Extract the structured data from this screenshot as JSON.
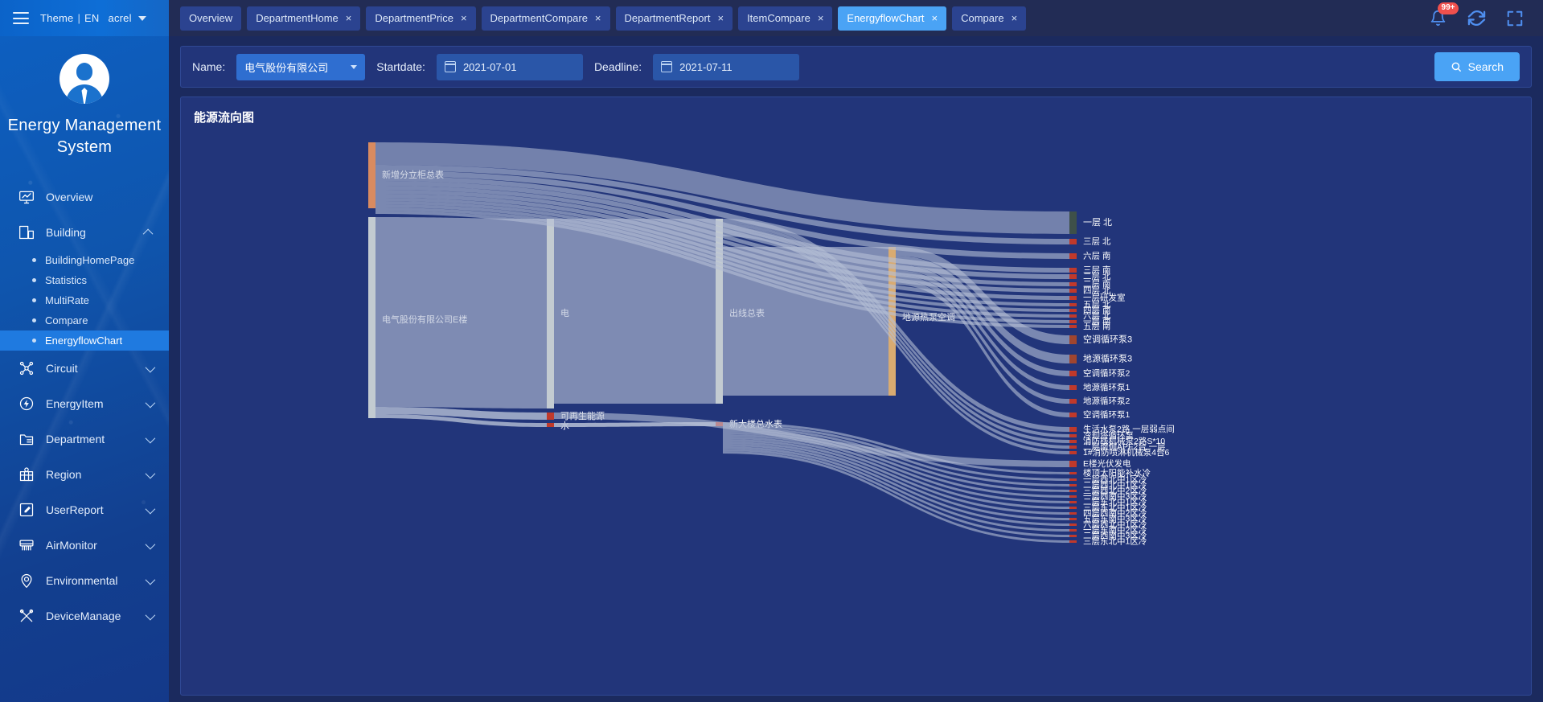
{
  "topbar": {
    "menu_icon": "hamburger-icon",
    "theme_label": "Theme",
    "divider": "|",
    "lang_label": "EN",
    "user_label": "acrel",
    "notification_badge": "99+",
    "tabs": [
      {
        "label": "Overview",
        "closable": false,
        "active": false
      },
      {
        "label": "DepartmentHome",
        "closable": true,
        "active": false
      },
      {
        "label": "DepartmentPrice",
        "closable": true,
        "active": false
      },
      {
        "label": "DepartmentCompare",
        "closable": true,
        "active": false
      },
      {
        "label": "DepartmentReport",
        "closable": true,
        "active": false
      },
      {
        "label": "ItemCompare",
        "closable": true,
        "active": false
      },
      {
        "label": "EnergyflowChart",
        "closable": true,
        "active": true
      },
      {
        "label": "Compare",
        "closable": true,
        "active": false
      }
    ],
    "close_glyph": "×",
    "icons": [
      "bell-icon",
      "refresh-icon",
      "fullscreen-icon"
    ]
  },
  "sidebar": {
    "brand_title": "Energy Management System",
    "avatar": "user-avatar",
    "items": [
      {
        "label": "Overview",
        "icon": "monitor-chart-icon",
        "expandable": false,
        "expanded": false
      },
      {
        "label": "Building",
        "icon": "building-icon",
        "expandable": true,
        "expanded": true
      },
      {
        "label": "Circuit",
        "icon": "circuit-icon",
        "expandable": true,
        "expanded": false
      },
      {
        "label": "EnergyItem",
        "icon": "energy-bolt-icon",
        "expandable": true,
        "expanded": false
      },
      {
        "label": "Department",
        "icon": "folder-icon",
        "expandable": true,
        "expanded": false
      },
      {
        "label": "Region",
        "icon": "region-map-icon",
        "expandable": true,
        "expanded": false
      },
      {
        "label": "UserReport",
        "icon": "edit-report-icon",
        "expandable": true,
        "expanded": false
      },
      {
        "label": "AirMonitor",
        "icon": "air-conditioner-icon",
        "expandable": true,
        "expanded": false
      },
      {
        "label": "Environmental",
        "icon": "location-pin-icon",
        "expandable": true,
        "expanded": false
      },
      {
        "label": "DeviceManage",
        "icon": "tools-icon",
        "expandable": true,
        "expanded": false
      }
    ],
    "building_subitems": [
      {
        "label": "BuildingHomePage",
        "active": false
      },
      {
        "label": "Statistics",
        "active": false
      },
      {
        "label": "MultiRate",
        "active": false
      },
      {
        "label": "Compare",
        "active": false
      },
      {
        "label": "EnergyflowChart",
        "active": true
      }
    ]
  },
  "filter": {
    "name_label": "Name:",
    "name_value": "电气股份有限公司",
    "startdate_label": "Startdate:",
    "startdate_value": "2021-07-01",
    "deadline_label": "Deadline:",
    "deadline_value": "2021-07-11",
    "search_label": "Search",
    "search_icon": "search-icon"
  },
  "panel": {
    "title": "能源流向图"
  },
  "chart_data": {
    "type": "sankey",
    "title": "能源流向图",
    "accent_colors": {
      "node_orange": "#d98b60",
      "node_gray": "#c3cbd1",
      "node_tan": "#d9ab71",
      "node_red": "#c0392b",
      "node_dark": "#3e5049",
      "link": "#b6c0d6",
      "background": "#22357a"
    },
    "columns": [
      {
        "index": 0,
        "nodes": [
          {
            "name": "新增分立柜总表",
            "color": "#d98b60",
            "value": 1100
          },
          {
            "name": "电气股份有限公司E楼",
            "color": "#c3cbd1",
            "value": 3050
          }
        ]
      },
      {
        "index": 1,
        "nodes": [
          {
            "name": "电",
            "color": "#c3cbd1",
            "value": 2830
          },
          {
            "name": "可再生能源",
            "color": "#c0392b",
            "value": 130
          },
          {
            "name": "水",
            "color": "#c0392b",
            "value": 70
          }
        ]
      },
      {
        "index": 2,
        "nodes": [
          {
            "name": "出线总表",
            "color": "#c3cbd1",
            "value": 2450
          },
          {
            "name": "新大楼总水表",
            "color": "#c0392b",
            "value": 70
          }
        ]
      },
      {
        "index": 3,
        "nodes": [
          {
            "name": "地源热泵空调",
            "color": "#d9ab71",
            "value": 900
          }
        ]
      },
      {
        "index": 4,
        "nodes": [
          {
            "name": "一层 北",
            "color": "#3e5049"
          },
          {
            "name": "三层 北",
            "color": "#c0392b"
          },
          {
            "name": "六层 南",
            "color": "#c0392b"
          },
          {
            "name": "三层 南",
            "color": "#c0392b"
          },
          {
            "name": "二层 北",
            "color": "#c0392b"
          },
          {
            "name": "二层 南",
            "color": "#c0392b"
          },
          {
            "name": "四层 北",
            "color": "#c0392b"
          },
          {
            "name": "一层研发室",
            "color": "#c0392b"
          },
          {
            "name": "五层 北",
            "color": "#c0392b"
          },
          {
            "name": "四层 南",
            "color": "#c0392b"
          },
          {
            "name": "六层 北",
            "color": "#c0392b"
          },
          {
            "name": "一层 南",
            "color": "#c0392b"
          },
          {
            "name": "五层 南",
            "color": "#c0392b"
          },
          {
            "name": "空调循环泵3",
            "color": "#a0452f"
          },
          {
            "name": "地源循环泵3",
            "color": "#a0452f"
          },
          {
            "name": "空调循环泵2",
            "color": "#c0392b"
          },
          {
            "name": "地源循环泵1",
            "color": "#c0392b"
          },
          {
            "name": "地源循环泵2",
            "color": "#c0392b"
          },
          {
            "name": "空调循环泵1",
            "color": "#c0392b"
          },
          {
            "name": "生活水泵2路 一层弱点间",
            "color": "#c0392b"
          },
          {
            "name": "冷却塔循环泵",
            "color": "#c0392b"
          },
          {
            "name": "消防栈机械泵2路S*10",
            "color": "#c0392b"
          },
          {
            "name": "二层南侧APF2台 一层",
            "color": "#c0392b"
          },
          {
            "name": "1#消防喷淋机械泵4台6",
            "color": "#c0392b"
          },
          {
            "name": "E楼光伏发电",
            "color": "#c0392b"
          },
          {
            "name": "楼顶太阳能补水冷",
            "color": "#c0392b"
          },
          {
            "name": "一层西北中1区冷",
            "color": "#c0392b"
          },
          {
            "name": "二层西北中1区冷",
            "color": "#c0392b"
          },
          {
            "name": "三层西北中2区冷",
            "color": "#c0392b"
          },
          {
            "name": "一层西南中3区冷",
            "color": "#c0392b"
          },
          {
            "name": "二层东北中1区冷",
            "color": "#c0392b"
          },
          {
            "name": "三层东北中1区冷",
            "color": "#c0392b"
          },
          {
            "name": "四层西南中2区冷",
            "color": "#c0392b"
          },
          {
            "name": "五层东南中3区冷",
            "color": "#c0392b"
          },
          {
            "name": "六层西北中1区冷",
            "color": "#c0392b"
          },
          {
            "name": "一层东南中2区冷",
            "color": "#c0392b"
          },
          {
            "name": "二层西南中3区冷",
            "color": "#c0392b"
          },
          {
            "name": "三层东北中1区冷",
            "color": "#c0392b"
          }
        ]
      }
    ]
  }
}
